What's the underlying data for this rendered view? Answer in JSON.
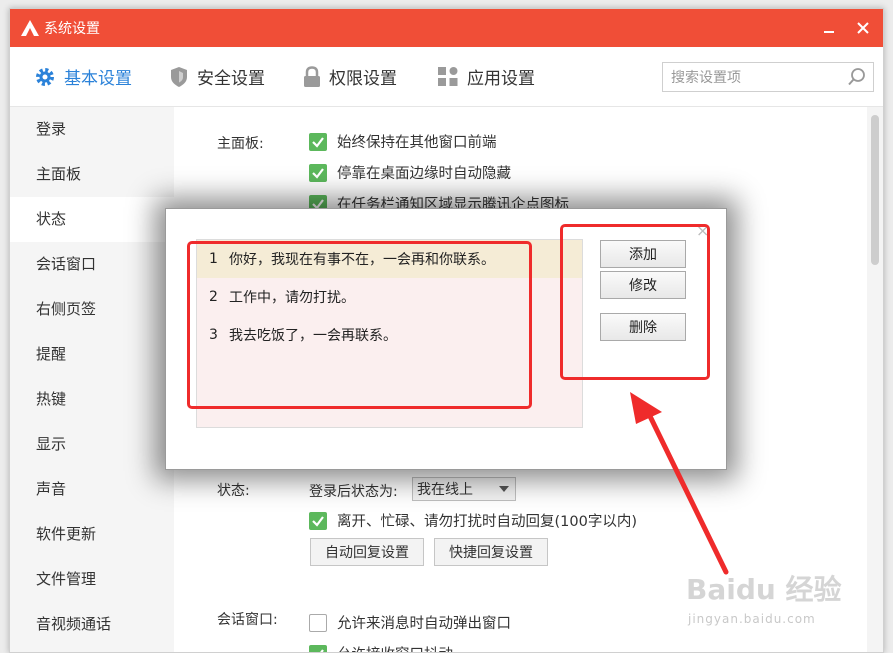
{
  "window": {
    "title": "系统设置"
  },
  "topnav": {
    "tabs": [
      {
        "label": "基本设置",
        "icon": "gear-icon",
        "active": true
      },
      {
        "label": "安全设置",
        "icon": "shield-icon",
        "active": false
      },
      {
        "label": "权限设置",
        "icon": "lock-icon",
        "active": false
      },
      {
        "label": "应用设置",
        "icon": "apps-grid-icon",
        "active": false
      }
    ],
    "search_placeholder": "搜索设置项"
  },
  "sidebar": {
    "items": [
      "登录",
      "主面板",
      "状态",
      "会话窗口",
      "右侧页签",
      "提醒",
      "热键",
      "显示",
      "声音",
      "软件更新",
      "文件管理",
      "音视频通话"
    ],
    "active_index": 2
  },
  "content": {
    "main_panel_label": "主面板:",
    "main_panel_options": [
      {
        "label": "始终保持在其他窗口前端",
        "checked": true
      },
      {
        "label": "停靠在桌面边缘时自动隐藏",
        "checked": true
      },
      {
        "label": "在任务栏通知区域显示腾讯企点图标",
        "checked": true
      }
    ],
    "status_label": "状态:",
    "status_after_login_label": "登录后状态为:",
    "status_select_value": "我在线上",
    "auto_reply_option": {
      "label": "离开、忙碌、请勿打扰时自动回复(100字以内)",
      "checked": true
    },
    "auto_reply_settings_button": "自动回复设置",
    "quick_reply_settings_button": "快捷回复设置",
    "chat_window_label": "会话窗口:",
    "chat_window_options": [
      {
        "label": "允许来消息时自动弹出窗口",
        "checked": false
      },
      {
        "label": "允许接收窗口抖动",
        "checked": true
      }
    ]
  },
  "dialog": {
    "messages": [
      {
        "num": "1",
        "text": "你好，我现在有事不在，一会再和你联系。"
      },
      {
        "num": "2",
        "text": "工作中，请勿打扰。"
      },
      {
        "num": "3",
        "text": "我去吃饭了，一会再联系。"
      }
    ],
    "add_button": "添加",
    "edit_button": "修改",
    "delete_button": "删除",
    "close_glyph": "×"
  },
  "watermark": {
    "main": "Baidu 经验",
    "sub": "jingyan.baidu.com"
  },
  "colors": {
    "titlebar": "#f04e37",
    "accent": "#2b82d9",
    "checkbox": "#5cb85c",
    "annotation": "#ef2b2b"
  }
}
